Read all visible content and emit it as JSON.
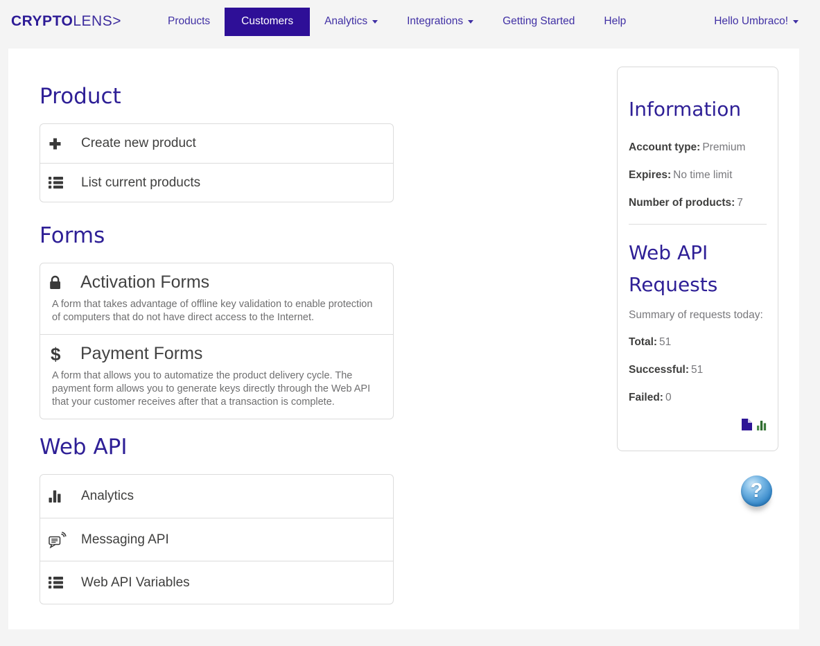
{
  "nav": {
    "logo_bold": "CRYPTO",
    "logo_light": "LENS>",
    "items": [
      {
        "label": "Products"
      },
      {
        "label": "Customers"
      },
      {
        "label": "Analytics"
      },
      {
        "label": "Integrations"
      },
      {
        "label": "Getting Started"
      },
      {
        "label": "Help"
      }
    ],
    "user_menu_label": "Hello Umbraco!"
  },
  "product": {
    "heading": "Product",
    "items": [
      {
        "icon": "plus-icon",
        "label": "Create new product"
      },
      {
        "icon": "list-icon",
        "label": "List current products"
      }
    ]
  },
  "forms": {
    "heading": "Forms",
    "items": [
      {
        "icon": "lock-icon",
        "title": "Activation Forms",
        "description": "A form that takes advantage of offline key validation to enable protection of computers that do not have direct access to the Internet."
      },
      {
        "icon": "dollar-icon",
        "title": "Payment Forms",
        "description": "A form that allows you to automatize the product delivery cycle. The payment form allows you to generate keys directly through the Web API that your customer receives after that a transaction is complete."
      }
    ]
  },
  "web_api": {
    "heading": "Web API",
    "items": [
      {
        "icon": "bar-chart-icon",
        "label": "Analytics"
      },
      {
        "icon": "messaging-icon",
        "label": "Messaging API"
      },
      {
        "icon": "list-icon",
        "label": "Web API Variables"
      }
    ]
  },
  "sidebar": {
    "information": {
      "heading": "Information",
      "fields": [
        {
          "label": "Account type:",
          "value": "Premium"
        },
        {
          "label": "Expires:",
          "value": "No time limit"
        },
        {
          "label": "Number of products:",
          "value": "7"
        }
      ]
    },
    "web_api_requests": {
      "heading": "Web API Requests",
      "summary": "Summary of requests today:",
      "fields": [
        {
          "label": "Total:",
          "value": "51"
        },
        {
          "label": "Successful:",
          "value": "51"
        },
        {
          "label": "Failed:",
          "value": "0"
        }
      ],
      "icons": [
        "file-icon",
        "bar-chart-green-icon"
      ]
    }
  },
  "help_button": {
    "icon": "question-icon"
  },
  "icons": {
    "plus-icon": "+",
    "list-icon": "☰",
    "lock-icon": "🔒",
    "dollar-icon": "$",
    "bar-chart-icon": "📊",
    "messaging-icon": "🗨",
    "file-icon": "📄",
    "bar-chart-green-icon": "📊",
    "question-icon": "?",
    "caret-down-icon": "▾"
  },
  "colors": {
    "heading_indigo": "#2e1f96",
    "nav_link": "#4030a4",
    "active_nav_bg": "#2e0f97",
    "page_bg": "#f4f4f4",
    "panel_border": "#dcdcdc",
    "body_text": "#3f3f3e",
    "muted_text": "#6f6f70",
    "file_icon_indigo": "#2d1596",
    "chart_icon_green": "#3c7a3c",
    "help_blue": "#3b8ccb"
  }
}
